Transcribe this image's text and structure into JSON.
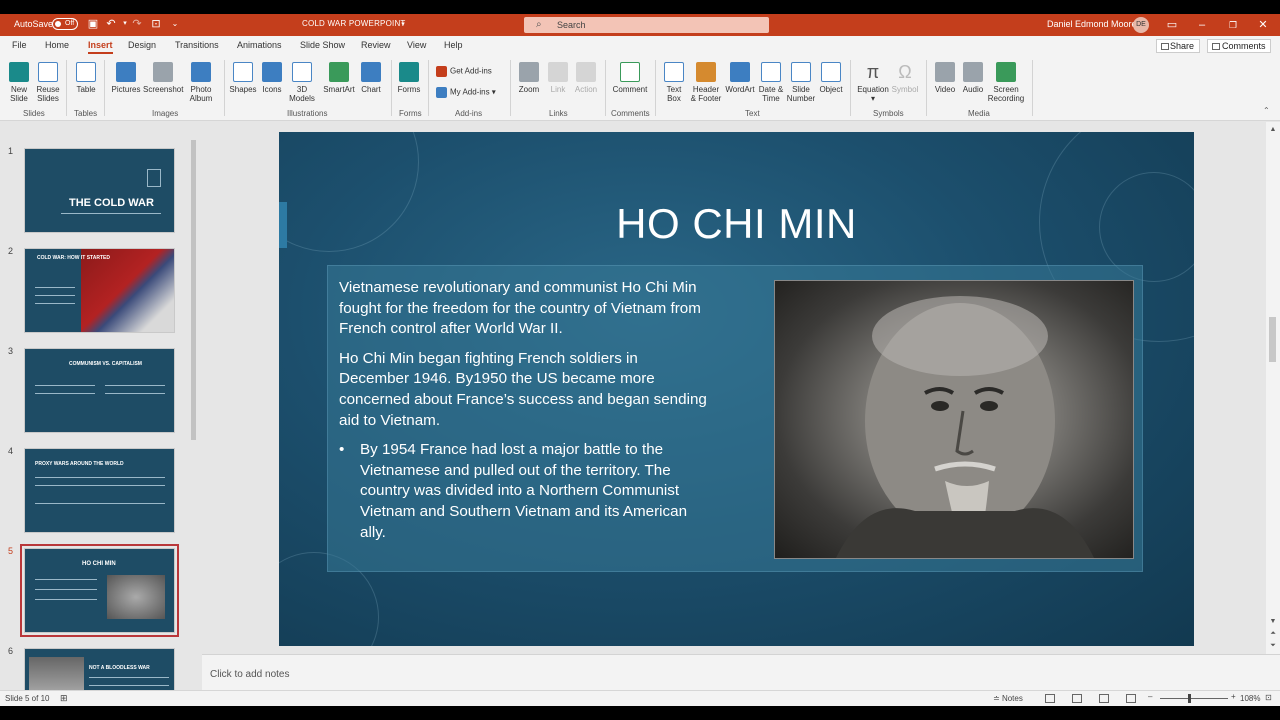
{
  "titlebar": {
    "autosave_label": "AutoSave",
    "autosave_state": "Off",
    "doc_title": "COLD WAR POWERPOINT",
    "search_placeholder": "Search",
    "user_name": "Daniel Edmond Moore",
    "user_initials": "DE"
  },
  "menu": {
    "tabs": [
      "File",
      "Home",
      "Insert",
      "Design",
      "Transitions",
      "Animations",
      "Slide Show",
      "Review",
      "View",
      "Help"
    ],
    "active": "Insert",
    "share_label": "Share",
    "comments_label": "Comments"
  },
  "ribbon": {
    "new_slide": [
      "New",
      "Slide"
    ],
    "reuse_slides": [
      "Reuse",
      "Slides"
    ],
    "table": "Table",
    "pictures": "Pictures",
    "screenshot": "Screenshot",
    "photo_album": [
      "Photo",
      "Album"
    ],
    "shapes": "Shapes",
    "icons": "Icons",
    "models_3d": [
      "3D",
      "Models"
    ],
    "smartart": "SmartArt",
    "chart": "Chart",
    "forms": "Forms",
    "get_addins": "Get Add-ins",
    "my_addins": "My Add-ins",
    "zoom": "Zoom",
    "link": "Link",
    "action": "Action",
    "comment": "Comment",
    "text_box": [
      "Text",
      "Box"
    ],
    "header_footer": [
      "Header",
      "& Footer"
    ],
    "wordart": "WordArt",
    "date_time": [
      "Date &",
      "Time"
    ],
    "slide_number": [
      "Slide",
      "Number"
    ],
    "object": "Object",
    "equation": "Equation",
    "symbol": "Symbol",
    "video": "Video",
    "audio": "Audio",
    "screen_recording": [
      "Screen",
      "Recording"
    ],
    "groups": [
      "Slides",
      "Tables",
      "Images",
      "Illustrations",
      "Forms",
      "Add-ins",
      "Links",
      "Comments",
      "Text",
      "Symbols",
      "Media"
    ]
  },
  "thumbnails": [
    {
      "num": "1",
      "title": "THE COLD WAR"
    },
    {
      "num": "2",
      "title": "COLD WAR: HOW IT STARTED"
    },
    {
      "num": "3",
      "title": "COMMUNISM VS. CAPITALISM"
    },
    {
      "num": "4",
      "title": "PROXY WARS AROUND THE WORLD"
    },
    {
      "num": "5",
      "title": "HO CHI MIN"
    },
    {
      "num": "6",
      "title": "NOT A BLOODLESS WAR"
    }
  ],
  "slide": {
    "title": "HO CHI MIN",
    "para1": "Vietnamese revolutionary and communist Ho Chi Min fought for the freedom for the country of Vietnam from French control after World War II.",
    "para2": "Ho Chi Min began fighting French soldiers in December 1946. By1950 the US became more concerned about France’s success and began sending aid to Vietnam.",
    "bullet1": "By 1954 France had lost a major battle to the Vietnamese and pulled out of the territory. The country was divided into a Northern Communist Vietnam and Southern Vietnam and its American ally."
  },
  "notes_placeholder": "Click to add notes",
  "status": {
    "slide_info": "Slide 5 of 10",
    "notes_label": "Notes",
    "zoom_pct": "108%"
  },
  "colors": {
    "accent": "#c43e1c",
    "slide_bg": "#1c4f6d"
  }
}
